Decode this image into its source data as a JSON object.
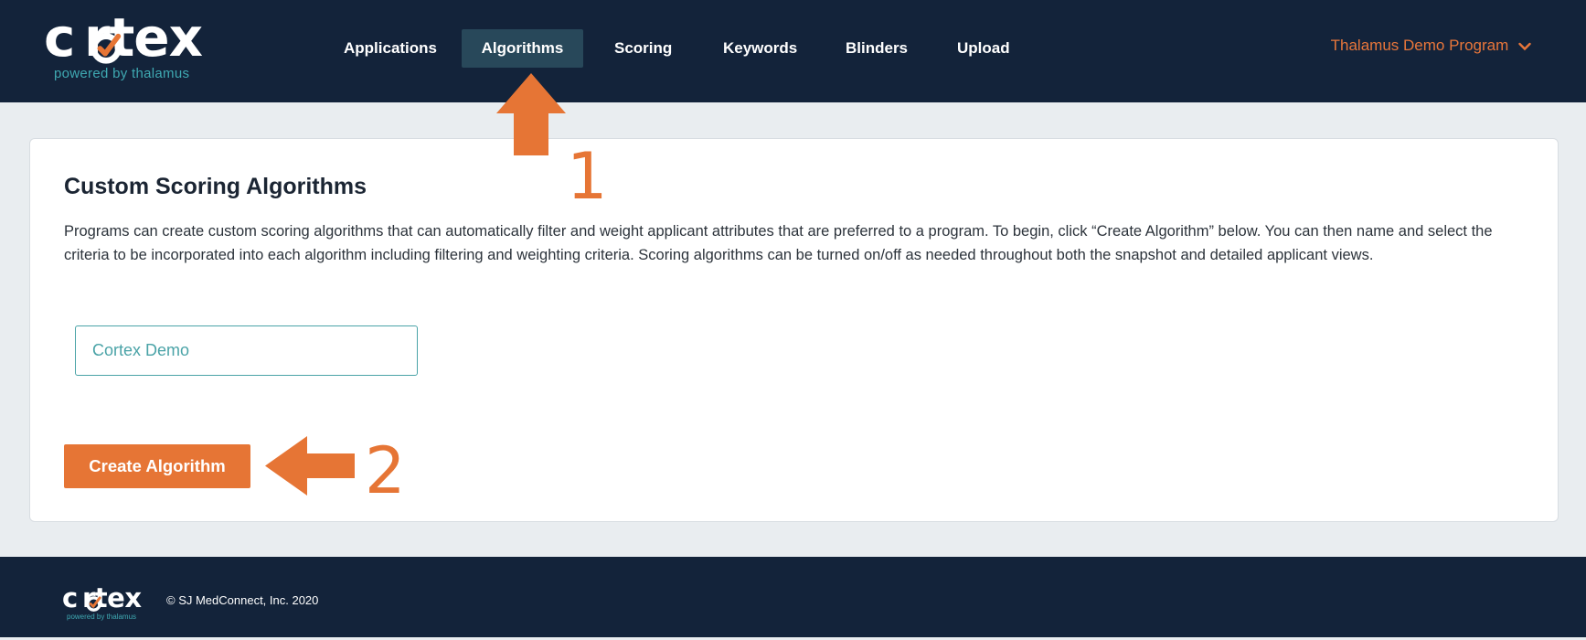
{
  "header": {
    "logo_word": "c rtex",
    "logo_tagline": "powered by thalamus",
    "nav": [
      {
        "label": "Applications"
      },
      {
        "label": "Algorithms"
      },
      {
        "label": "Scoring"
      },
      {
        "label": "Keywords"
      },
      {
        "label": "Blinders"
      },
      {
        "label": "Upload"
      }
    ],
    "active_nav": "Algorithms",
    "program_label": "Thalamus Demo Program",
    "program_icon": "chevron-down-icon"
  },
  "main": {
    "title": "Custom Scoring Algorithms",
    "description": "Programs can create custom scoring algorithms that can automatically filter and weight applicant attributes that are preferred to a program. To begin, click “Create Algorithm” below. You can then name and select the criteria to be incorporated into each algorithm including filtering and weighting criteria. Scoring algorithms can be turned on/off as needed throughout both the snapshot and detailed applicant views.",
    "algorithm_name": "Cortex Demo",
    "create_button": "Create Algorithm"
  },
  "annotations": {
    "step1": "1",
    "step2": "2"
  },
  "footer": {
    "logo_word": "c rtex",
    "logo_tagline": "powered by thalamus",
    "copyright": "© SJ MedConnect, Inc. 2020"
  },
  "colors": {
    "navy": "#13233a",
    "accent_orange": "#e67535",
    "teal": "#4aa3a7",
    "active_tab": "#28485a"
  }
}
